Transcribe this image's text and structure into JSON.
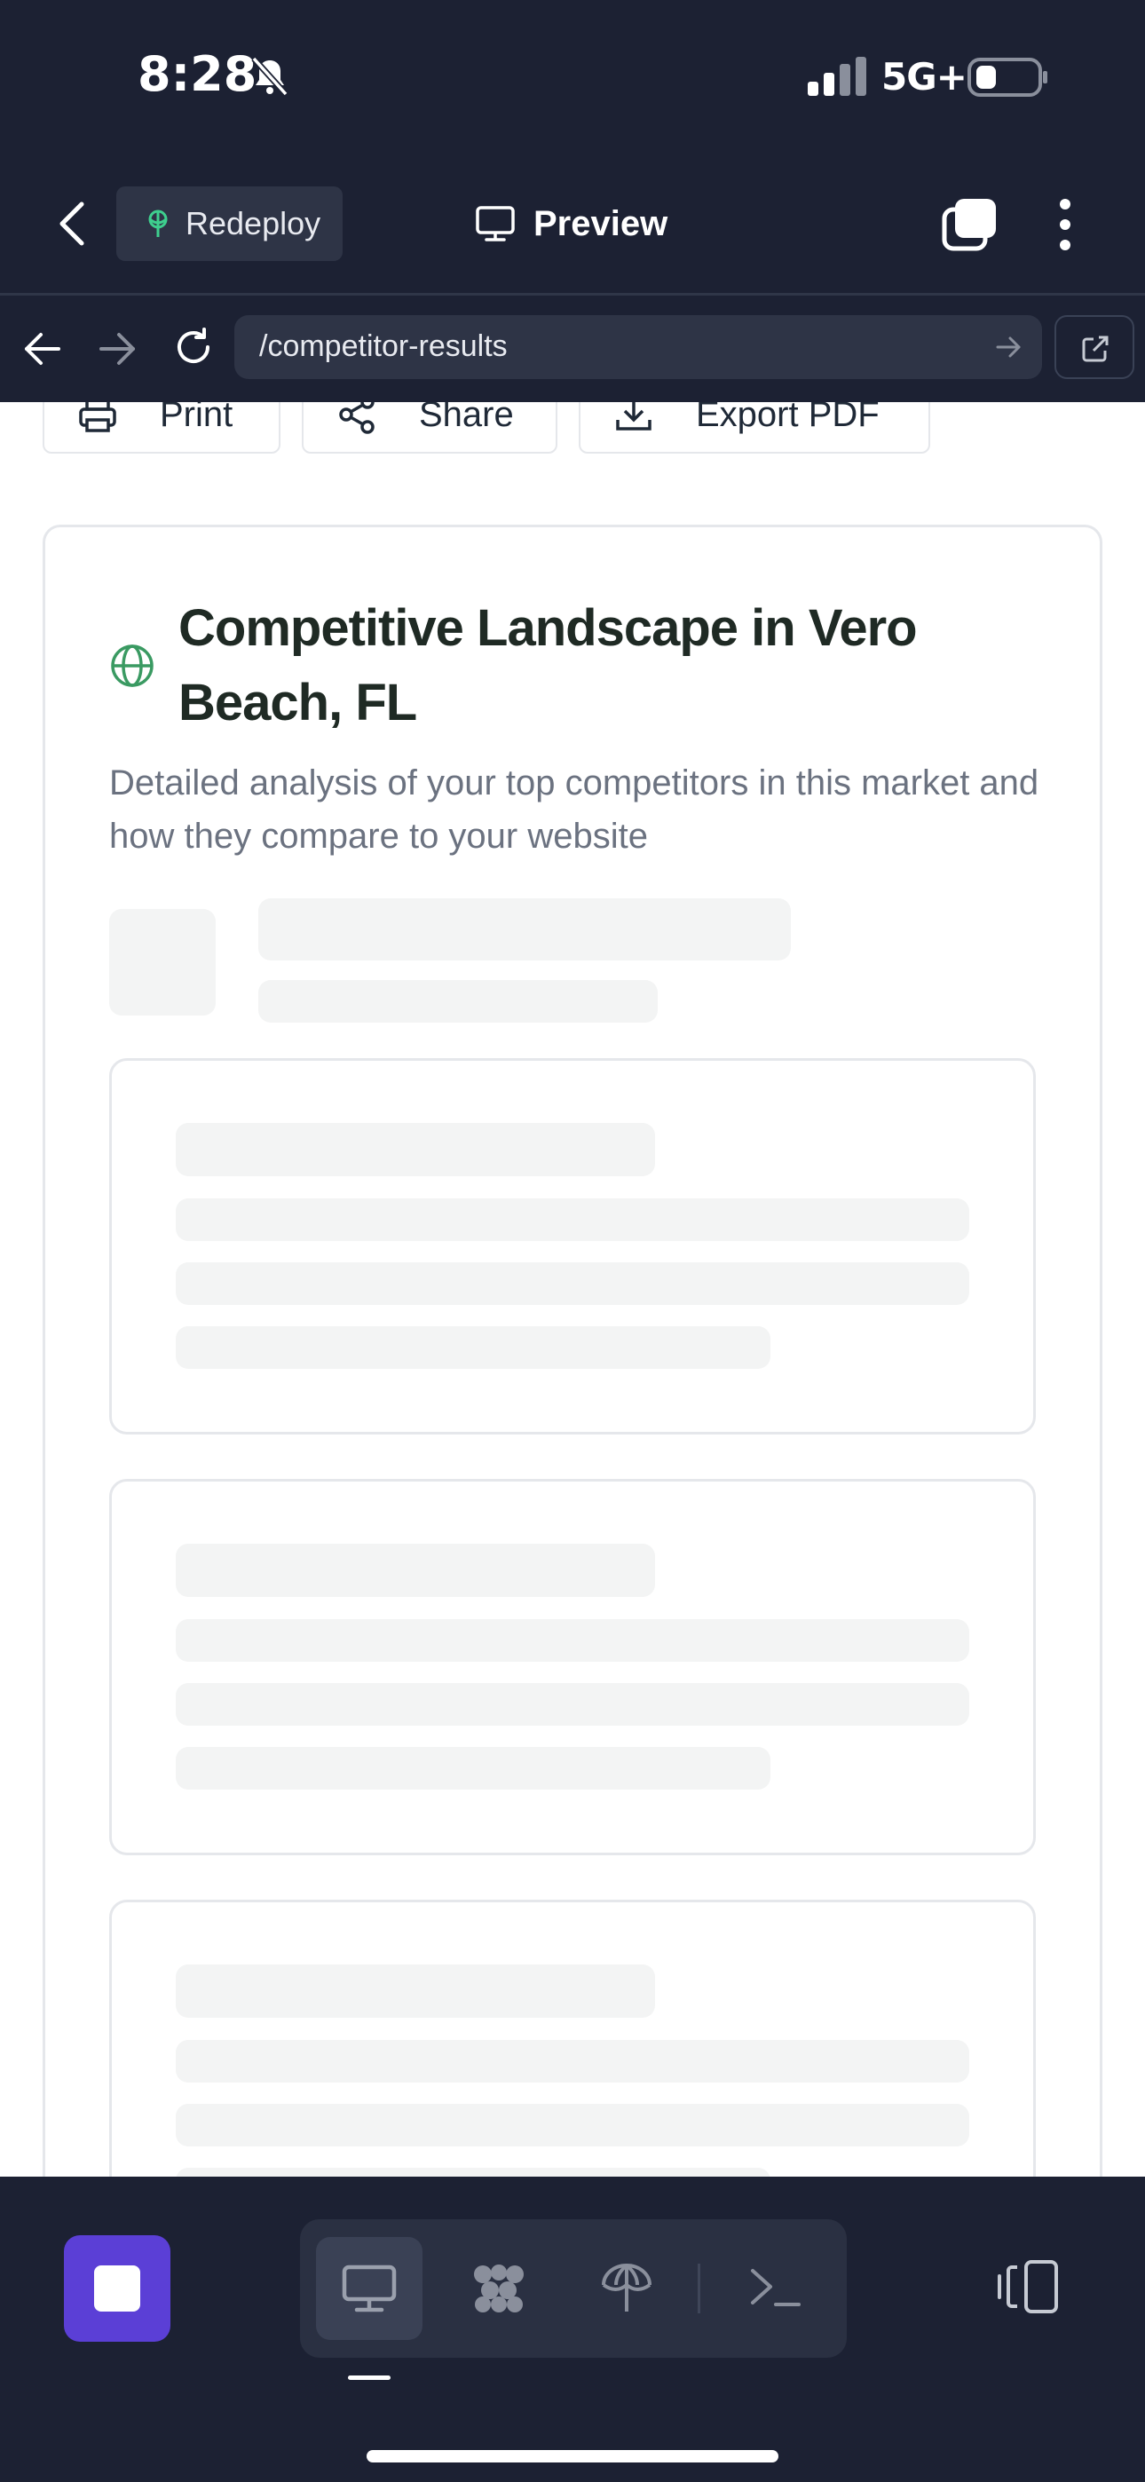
{
  "status_bar": {
    "time": "8:28",
    "network": "5G+"
  },
  "toolbar": {
    "redeploy_label": "Redeploy",
    "preview_label": "Preview"
  },
  "browser": {
    "url": "/competitor-results"
  },
  "actions": {
    "print_label": "Print",
    "share_label": "Share",
    "export_label": "Export PDF"
  },
  "card": {
    "title": "Competitive Landscape in Vero Beach, FL",
    "description": "Detailed analysis of your top competitors in this market and how they compare to your website"
  },
  "colors": {
    "background_dark": "#1c2133",
    "accent_purple": "#5b3fd6",
    "globe_green": "#3a9a62",
    "skeleton": "#f3f4f4"
  },
  "icons": [
    "bell-slash-icon",
    "signal-icon",
    "battery-icon",
    "chevron-left-icon",
    "antenna-icon",
    "monitor-icon",
    "windows-icon",
    "kebab-icon",
    "arrow-left-icon",
    "arrow-right-icon",
    "reload-icon",
    "external-link-icon",
    "printer-icon",
    "share-icon",
    "download-icon",
    "globe-icon",
    "stop-icon",
    "agents-icon",
    "deploy-icon",
    "shell-icon",
    "layout-toggle-icon"
  ]
}
